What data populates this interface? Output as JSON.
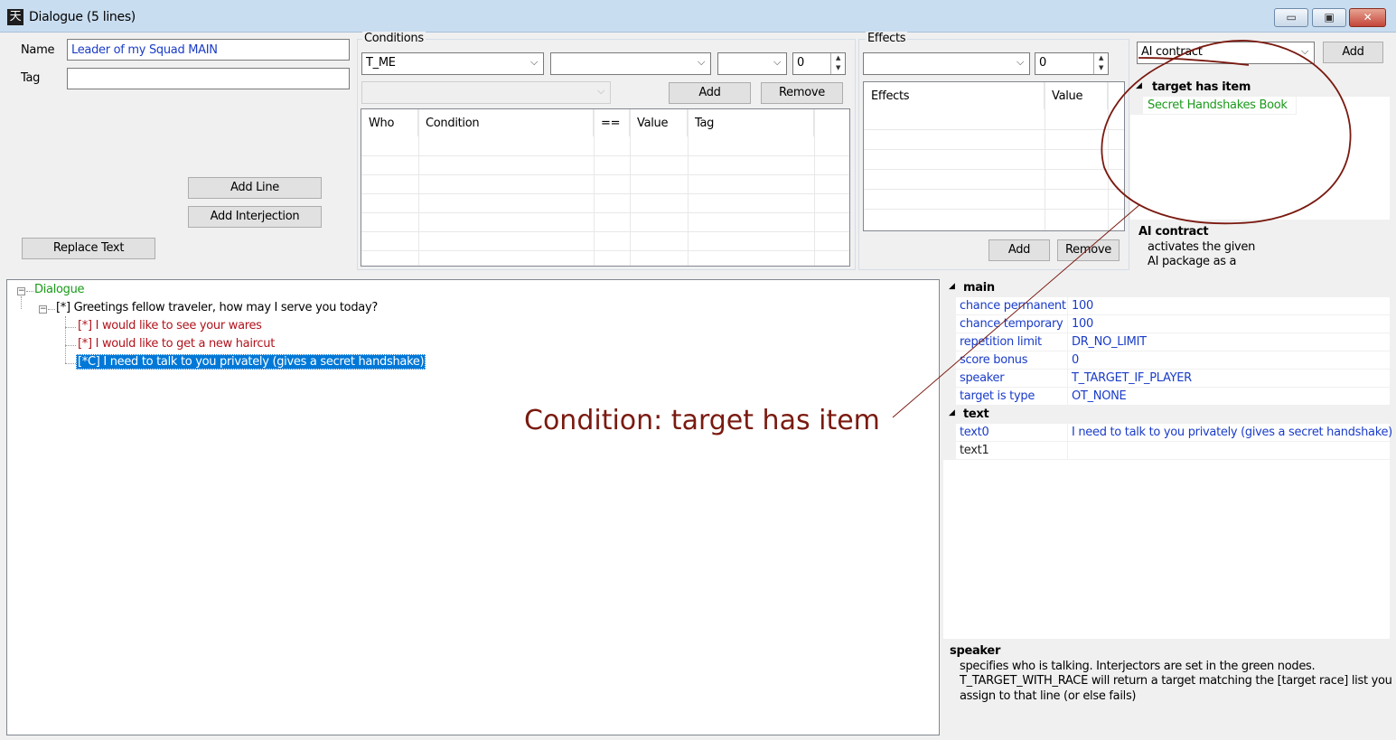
{
  "window": {
    "title": "Dialogue (5 lines)",
    "icon_glyph": "天",
    "minimize_glyph": "▭",
    "maximize_glyph": "▣",
    "close_glyph": "✕"
  },
  "fields": {
    "name_label": "Name",
    "name_value": "Leader of my Squad MAIN",
    "tag_label": "Tag",
    "tag_value": ""
  },
  "buttons": {
    "add_line": "Add Line",
    "add_interjection": "Add Interjection",
    "replace_text": "Replace Text"
  },
  "conditions": {
    "label": "Conditions",
    "who_combo": "T_ME",
    "condition_combo": "",
    "compare_combo": "",
    "value_spin": "0",
    "tag_combo": "",
    "add": "Add",
    "remove": "Remove",
    "columns": [
      "Who",
      "Condition",
      "==",
      "Value",
      "Tag"
    ]
  },
  "effects": {
    "label": "Effects",
    "effect_combo": "",
    "value_spin": "0",
    "columns": [
      "Effects",
      "Value"
    ],
    "add": "Add",
    "remove": "Remove"
  },
  "ai": {
    "combo": "AI contract",
    "add": "Add",
    "category": "target has item",
    "item": "Secret Handshakes Book",
    "help_title": "AI contract",
    "help_line1": "activates the given",
    "help_line2": "AI package as a"
  },
  "tree": {
    "root": "Dialogue",
    "greeting": "[*] Greetings fellow traveler, how may I serve you today?",
    "reply1": "[*] I would like to see your wares",
    "reply2": "[*] I would like to get a new haircut",
    "reply3": "[*C] I need to talk to you privately (gives a secret handshake)",
    "collapse_glyph": "−"
  },
  "annotation": {
    "text": "Condition: target has item",
    "color": "#7a1a10"
  },
  "properties": {
    "main_label": "main",
    "main": [
      {
        "name": "chance permanent",
        "value": "100"
      },
      {
        "name": "chance temporary",
        "value": "100"
      },
      {
        "name": "repetition limit",
        "value": "DR_NO_LIMIT"
      },
      {
        "name": "score bonus",
        "value": "0"
      },
      {
        "name": "speaker",
        "value": "T_TARGET_IF_PLAYER"
      },
      {
        "name": "target is type",
        "value": "OT_NONE"
      }
    ],
    "text_label": "text",
    "text": [
      {
        "name": "text0",
        "value": "I need to talk to you privately (gives a secret handshake)"
      },
      {
        "name": "text1",
        "value": ""
      }
    ],
    "help_title": "speaker",
    "help_line1": "specifies who is talking.  Interjectors are set in the green nodes.",
    "help_line2": "T_TARGET_WITH_RACE will return a target matching the [target race] list you",
    "help_line3": "assign to that line (or else fails)"
  }
}
